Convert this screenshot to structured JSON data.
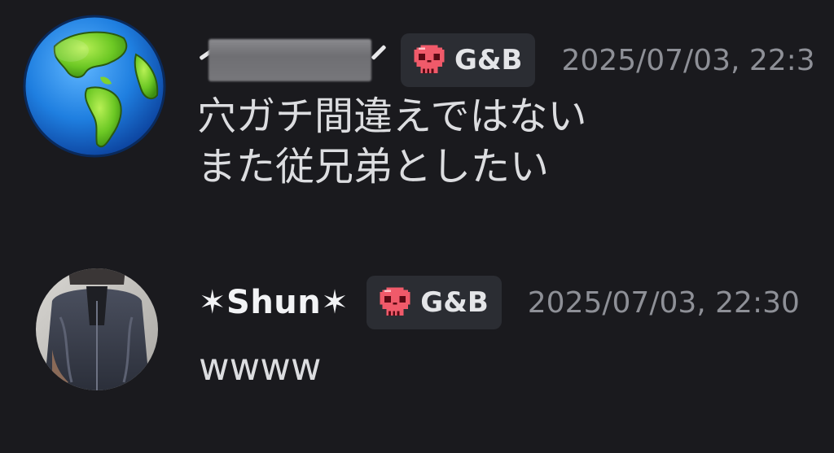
{
  "messages": [
    {
      "avatar_icon": "globe-americas-icon",
      "username": "",
      "username_redacted": true,
      "badge": {
        "icon": "skull-icon",
        "label": "G&B"
      },
      "timestamp": "2025/07/03, 22:3",
      "content_lines": [
        "穴ガチ間違えではない",
        "また従兄弟としたい"
      ]
    },
    {
      "avatar_icon": "user-photo-avatar",
      "username": "✶Shun✶",
      "username_redacted": false,
      "badge": {
        "icon": "skull-icon",
        "label": "G&B"
      },
      "timestamp": "2025/07/03, 22:30",
      "content_lines": [
        "wwww"
      ]
    }
  ],
  "colors": {
    "background": "#1a1a1e",
    "badge_bg": "#2b2d33",
    "skull": "#f05a6a",
    "timestamp": "#8e9097",
    "text": "#dcdde0"
  }
}
